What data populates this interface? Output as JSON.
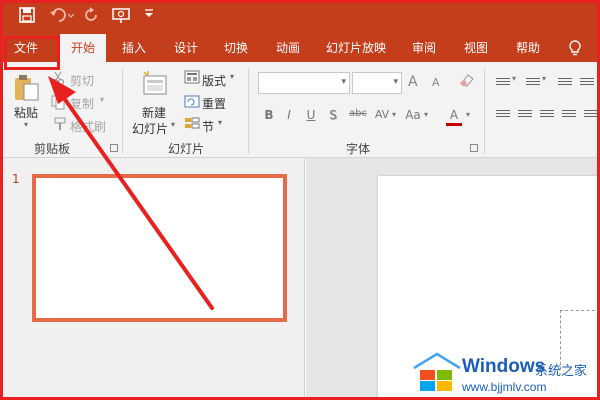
{
  "quick_access": {
    "icons": [
      "save-icon",
      "undo-icon",
      "redo-icon",
      "present-from-start-icon",
      "customize-qat-icon"
    ],
    "customize_glyph": "₹"
  },
  "tabs": [
    {
      "label": "文件",
      "active": false
    },
    {
      "label": "开始",
      "active": true
    },
    {
      "label": "插入",
      "active": false
    },
    {
      "label": "设计",
      "active": false
    },
    {
      "label": "切换",
      "active": false
    },
    {
      "label": "动画",
      "active": false
    },
    {
      "label": "幻灯片放映",
      "active": false
    },
    {
      "label": "审阅",
      "active": false
    },
    {
      "label": "视图",
      "active": false
    },
    {
      "label": "帮助",
      "active": false
    }
  ],
  "ribbon": {
    "clipboard": {
      "group_label": "剪贴板",
      "paste": "粘贴",
      "cut": "剪切",
      "copy": "复制",
      "format_painter": "格式刷"
    },
    "slides": {
      "group_label": "幻灯片",
      "new_slide_line1": "新建",
      "new_slide_line2": "幻灯片",
      "layout": "版式",
      "reset": "重置",
      "section": "节"
    },
    "font": {
      "group_label": "字体",
      "bold": "B",
      "italic": "I",
      "underline": "U",
      "shadow": "S",
      "strike": "abc",
      "spacing": "AV",
      "case": "Aa",
      "color": "A",
      "grow": "A",
      "shrink": "A"
    }
  },
  "thumbnails": {
    "slide_number": "1"
  },
  "watermark": {
    "brand": "Windows",
    "cn": "系统之家",
    "url": "www.bjjmlv.com"
  },
  "colors": {
    "accent": "#c43e1c",
    "annotation": "#e8201f",
    "thumb_border": "#e46a4a"
  }
}
